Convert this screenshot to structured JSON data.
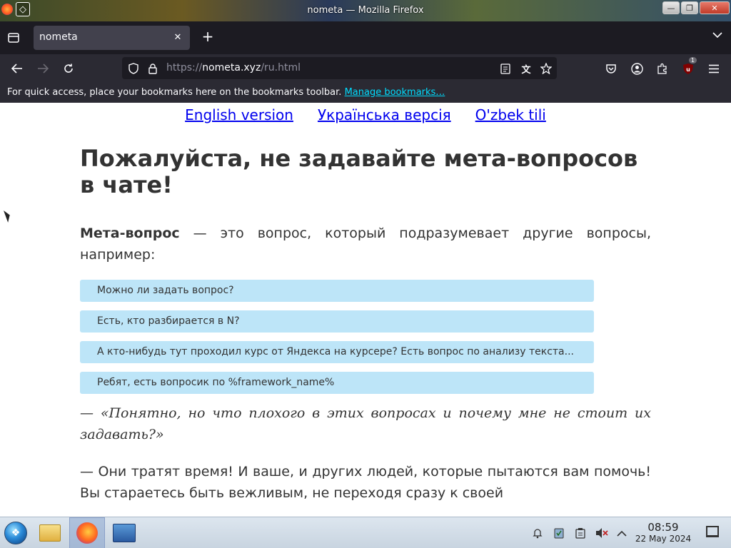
{
  "window": {
    "title": "nometa — Mozilla Firefox",
    "minimize_glyph": "—",
    "maximize_glyph": "❐",
    "close_glyph": "✕"
  },
  "tabs": [
    {
      "label": "nometa",
      "active": true
    }
  ],
  "toolbar": {
    "url_scheme": "https://",
    "url_host": "nometa.xyz",
    "url_path": "/ru.html",
    "extension_badge": "1"
  },
  "bookmarks_bar": {
    "message": "For quick access, place your bookmarks here on the bookmarks toolbar.",
    "manage_link": "Manage bookmarks…"
  },
  "page": {
    "language_links": [
      "English version",
      "Українська версія",
      "O'zbek tili"
    ],
    "heading": "Пожалуйста, не задавайте мета-вопросов в чате!",
    "intro_bold": "Мета-вопрос",
    "intro_rest": " — это вопрос, который подразумевает другие вопросы, например:",
    "examples": [
      "Можно ли задать вопрос?",
      "Есть, кто разбирается в N?",
      "А кто-нибудь тут проходил курс от Яндекса на курсере? Есть вопрос по анализу текста...",
      "Ребят, есть вопросик по %framework_name%"
    ],
    "quote": "— «Понятно, но что плохого в этих вопросах и почему мне не стоит их задавать?»",
    "answer": "— Они тратят время! И ваше, и других людей, которые пытаются вам помочь! Вы стараетесь быть вежливым, не переходя сразу к своей"
  },
  "taskbar": {
    "time": "08:59",
    "date": "22 May 2024"
  },
  "colors": {
    "tab_strip_bg": "#1c1b22",
    "toolbar_bg": "#2b2a33",
    "example_bg": "#bde5f8",
    "link_color": "#0000ee"
  }
}
